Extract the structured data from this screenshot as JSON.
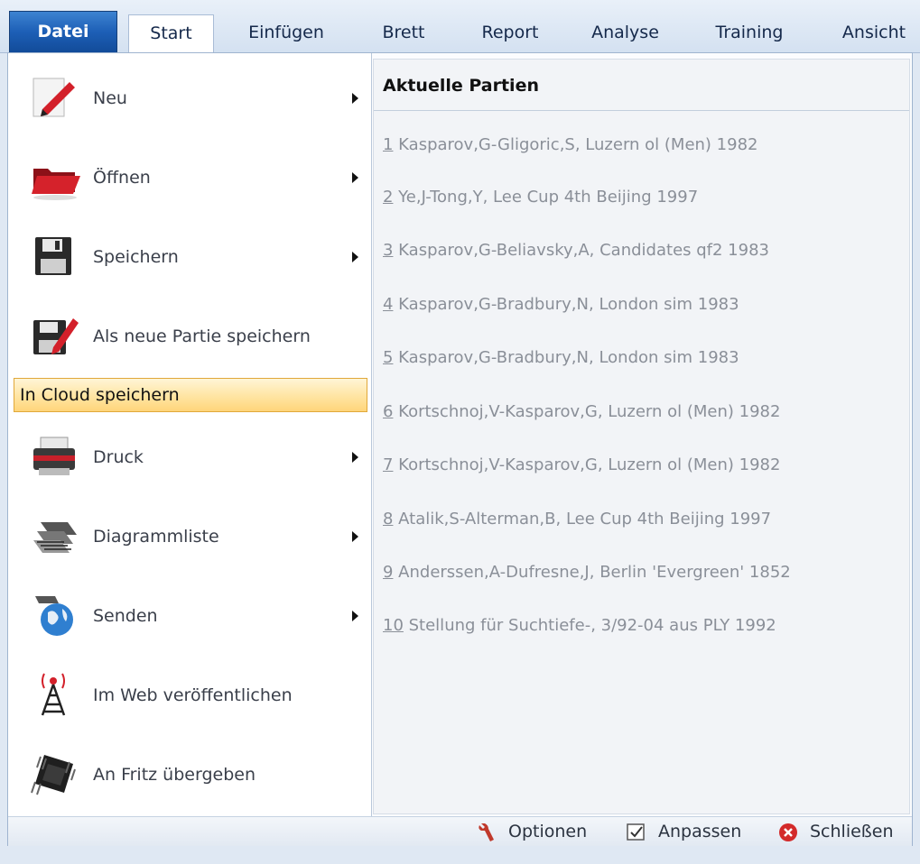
{
  "ribbon": {
    "tabs": [
      "Datei",
      "Start",
      "Einfügen",
      "Brett",
      "Report",
      "Analyse",
      "Training",
      "Ansicht"
    ]
  },
  "file_menu": {
    "items": [
      {
        "label": "Neu",
        "icon": "pencil-icon",
        "submenu": true
      },
      {
        "label": "Öffnen",
        "icon": "folder-icon",
        "submenu": true
      },
      {
        "label": "Speichern",
        "icon": "floppy-disk-icon",
        "submenu": true
      },
      {
        "label": "Als neue Partie speichern",
        "icon": "save-as-icon",
        "submenu": false
      },
      {
        "label": "In Cloud speichern",
        "highlighted": true
      },
      {
        "label": "Druck",
        "icon": "printer-icon",
        "submenu": true
      },
      {
        "label": "Diagrammliste",
        "icon": "chessboard-icon",
        "submenu": true
      },
      {
        "label": "Senden",
        "icon": "globe-icon",
        "submenu": true
      },
      {
        "label": "Im Web veröffentlichen",
        "icon": "antenna-icon",
        "submenu": false
      },
      {
        "label": "An Fritz übergeben",
        "icon": "chip-icon",
        "submenu": false
      }
    ]
  },
  "recent": {
    "title": "Aktuelle Partien",
    "games": [
      {
        "num": "1",
        "text": " Kasparov,G-Gligoric,S, Luzern ol (Men) 1982"
      },
      {
        "num": "2",
        "text": " Ye,J-Tong,Y, Lee Cup 4th Beijing 1997"
      },
      {
        "num": "3",
        "text": " Kasparov,G-Beliavsky,A, Candidates qf2 1983"
      },
      {
        "num": "4",
        "text": " Kasparov,G-Bradbury,N, London sim 1983"
      },
      {
        "num": "5",
        "text": " Kasparov,G-Bradbury,N, London sim 1983"
      },
      {
        "num": "6",
        "text": " Kortschnoj,V-Kasparov,G, Luzern ol (Men) 1982"
      },
      {
        "num": "7",
        "text": " Kortschnoj,V-Kasparov,G, Luzern ol (Men) 1982"
      },
      {
        "num": "8",
        "text": " Atalik,S-Alterman,B, Lee Cup 4th Beijing 1997"
      },
      {
        "num": "9",
        "text": " Anderssen,A-Dufresne,J, Berlin 'Evergreen' 1852"
      },
      {
        "num": "10",
        "text": " Stellung für Suchtiefe-, 3/92-04 aus PLY 1992"
      }
    ]
  },
  "footer": {
    "options": "Optionen",
    "customize": "Anpassen",
    "close": "Schließen"
  },
  "colors": {
    "accent": "#1d5fb6",
    "highlight": "#ffe6a6",
    "muted_text": "#8a8f98"
  }
}
